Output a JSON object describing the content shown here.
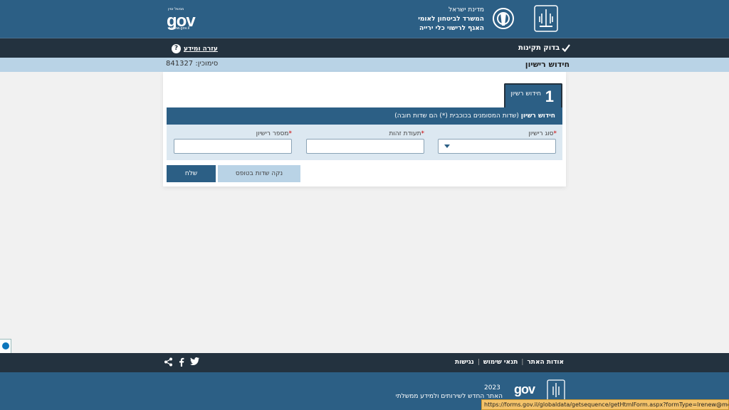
{
  "header": {
    "ministry_line1": "מדינת ישראל",
    "ministry_line2": "המשרד לביטחון לאומי",
    "ministry_line3": "האגף לרישוי כלי ירייה",
    "gov_logo_text": "gov",
    "gov_logo_top": "ממשל זמין",
    "gov_logo_bottom": "www.gov.il"
  },
  "nav": {
    "check_accessibility": "בדוק תקינות",
    "help_link": "עזרה ומידע",
    "help_icon_glyph": "?"
  },
  "title_bar": {
    "page_title": "חידוש רישיון",
    "reference": "סימוכין: 841327"
  },
  "form": {
    "step_number": "1",
    "step_label": "חידוש רשיון",
    "section_title": "חידוש רשיון",
    "section_note": " (שדות המסומנים בכוכבית (*) הם שדות חובה)",
    "required_mark": "*",
    "fields": [
      {
        "label": "סוג רישיון",
        "value": ""
      },
      {
        "label": "תעודת זהות",
        "value": ""
      },
      {
        "label": "מספר רישיון",
        "value": ""
      }
    ],
    "send_label": "שלח",
    "clear_label": "נקה שדות בטופס"
  },
  "footer": {
    "links": [
      "אודות האתר",
      "תנאי שימוש",
      "נגישות"
    ],
    "separator": "|",
    "year": "2023",
    "caption": "האתר החדש לשירותים ולמידע ממשלתי",
    "gov_text": "gov"
  },
  "status_bar": {
    "url": "https://forms.gov.il/globaldata/getsequence/getHtmlForm.aspx?formType=lrenew@mops.gov.il#"
  },
  "colors": {
    "primary": "#2c5f85",
    "dark": "#23323f",
    "light": "#b9d3e6"
  }
}
